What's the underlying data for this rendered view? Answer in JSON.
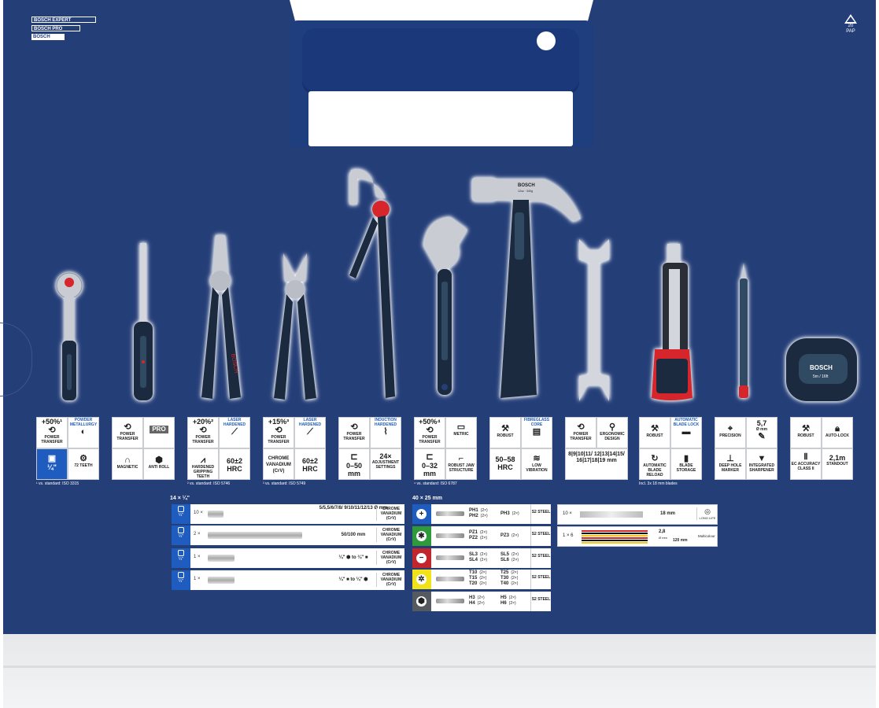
{
  "brand": {
    "expert": "BOSCH EXPERT",
    "pro": "BOSCH PRO",
    "bosch": "BOSCH"
  },
  "recycle": {
    "code": "20",
    "label": "PAP"
  },
  "colors": {
    "board": "#243e78",
    "accent_blue": "#1e5dbf",
    "tool_red": "#d6262c",
    "handle_dark": "#1b2a3f"
  },
  "tool_marks": {
    "pliers_logo": "BOSCH",
    "hammer_logo": "BOSCH",
    "hammer_weight": "12oz · 340g",
    "tape_logo": "BOSCH",
    "tape_size": "5m / 16ft"
  },
  "cards": [
    {
      "id": "ratchet",
      "tl_top": "+50%¹",
      "tl_label": "POWER TRANSFER",
      "tr_label": "POWDER METALLURGY",
      "bl_value": "¼\"",
      "br_label": "72 TEETH",
      "footnote": "¹ vs. standard: ISO 3315"
    },
    {
      "id": "screwdriver",
      "tl_label": "POWER TRANSFER",
      "tr_label": "PRO",
      "bl_label": "MAGNETIC",
      "br_label": "ANTI ROLL",
      "footnote": ""
    },
    {
      "id": "combination-pliers",
      "tl_top": "+20%²",
      "tl_label": "POWER TRANSFER",
      "tr_label": "LASER HARDENED",
      "bl_label": "HARDENED GRIPPING TEETH",
      "br_value": "60±2 HRC",
      "footnote": "² vs. standard: ISO 5746"
    },
    {
      "id": "side-cutter",
      "tl_top": "+15%³",
      "tl_label": "POWER TRANSFER",
      "tr_label": "LASER HARDENED",
      "bl_value": "CHROME VANADIUM (CrV)",
      "br_value": "60±2 HRC",
      "footnote": "³ vs. standard: ISO 5749"
    },
    {
      "id": "water-pump-pliers",
      "tl_label": "POWER TRANSFER",
      "tr_label": "INDUCTION HARDENED",
      "bl_value": "0–50 mm",
      "br_top": "24×",
      "br_label": "ADJUSTMENT SETTINGS",
      "footnote": ""
    },
    {
      "id": "adjustable-wrench",
      "tl_top": "+50%⁴",
      "tl_label": "POWER TRANSFER",
      "tr_label": "METRIC",
      "bl_value": "0–32 mm",
      "br_label": "ROBUST JAW STRUCTURE",
      "footnote": "⁴ vs. standard: ISO 6787"
    },
    {
      "id": "hammer",
      "tl_label": "ROBUST",
      "tr_label": "FIBREGLASS CORE",
      "bl_value": "50–58 HRC",
      "br_label": "LOW VIBRATION",
      "footnote": ""
    },
    {
      "id": "open-end-wrench",
      "tl_label": "POWER TRANSFER",
      "tr_label": "ERGONOMIC DESIGN",
      "bottom_value": "8|9|10|11/ 12|13|14|15/ 16|17|18|19 mm",
      "footnote": ""
    },
    {
      "id": "utility-knife",
      "tl_label": "ROBUST",
      "tr_label": "AUTOMATIC BLADE LOCK",
      "bl_label": "AUTOMATIC BLADE RELOAD",
      "br_label": "BLADE STORAGE",
      "footnote": "Incl. 3x 18 mm blades"
    },
    {
      "id": "pencil",
      "tl_label": "PRECISION",
      "tr_top": "5,7",
      "tr_label": "Ø mm",
      "bl_label": "DEEP HOLE MARKER",
      "br_label": "INTEGRATED SHARPENER",
      "footnote": ""
    },
    {
      "id": "tape-measure",
      "tl_label": "ROBUST",
      "tr_label": "AUTO-LOCK",
      "bl_label": "EC ACCURACY CLASS II",
      "br_top": "2,1m",
      "br_label": "STANDOUT",
      "footnote": ""
    }
  ],
  "socket_table": {
    "title": "14 × ¼\"",
    "drive": "¼\"",
    "rows": [
      {
        "qty": "10 ×",
        "sizes": "5/5,5/6/7/8/ 9/10/11/12/13 Ø mm",
        "material": "CHROME VANADIUM (CrV)"
      },
      {
        "qty": "2 ×",
        "sizes": "50/100 mm",
        "material": "CHROME VANADIUM (CrV)"
      },
      {
        "qty": "1 ×",
        "sizes": "¼\" ⬢ to ¼\" ■",
        "material": "CHROME VANADIUM (CrV)"
      },
      {
        "qty": "1 ×",
        "sizes": "¼\" ■ to ¼\" ⬢",
        "material": "CHROME VANADIUM (CrV)"
      }
    ]
  },
  "bit_table": {
    "title": "40 × 25 mm",
    "rows": [
      {
        "symbol": "+",
        "color": "#1e5dbf",
        "a1": "PH1",
        "a1q": "(2×)",
        "a2": "PH2",
        "a2q": "(2×)",
        "b1": "PH3",
        "b1q": "(2×)",
        "b2": "",
        "b2q": "",
        "b3": "",
        "b3q": "",
        "a3": "",
        "a3q": "",
        "steel": "S2 STEEL"
      },
      {
        "symbol": "✱",
        "color": "#2e9a3c",
        "a1": "PZ1",
        "a1q": "(2×)",
        "a2": "PZ2",
        "a2q": "(2×)",
        "b1": "PZ3",
        "b1q": "(2×)",
        "b2": "",
        "b2q": "",
        "b3": "",
        "b3q": "",
        "a3": "",
        "a3q": "",
        "steel": "S2 STEEL"
      },
      {
        "symbol": "−",
        "color": "#c0262c",
        "a1": "SL3",
        "a1q": "(2×)",
        "a2": "SL4",
        "a2q": "(2×)",
        "b1": "SL5",
        "b1q": "(2×)",
        "b2": "SL6",
        "b2q": "(2×)",
        "b3": "",
        "b3q": "",
        "a3": "",
        "a3q": "",
        "steel": "S2 STEEL"
      },
      {
        "symbol": "✲",
        "color": "#f2e21a",
        "a1": "T10",
        "a1q": "(2×)",
        "a2": "T15",
        "a2q": "(2×)",
        "a3": "T20",
        "a3q": "(2×)",
        "b1": "T25",
        "b1q": "(2×)",
        "b2": "T30",
        "b2q": "(2×)",
        "b3": "T40",
        "b3q": "(2×)",
        "steel": "S2 STEEL"
      },
      {
        "symbol": "⬢",
        "color": "#555a60",
        "a1": "H3",
        "a1q": "(2×)",
        "a2": "H4",
        "a2q": "(2×)",
        "b1": "H5",
        "b1q": "(2×)",
        "b2": "H6",
        "b2q": "(2×)",
        "b3": "",
        "b3q": "",
        "a3": "",
        "a3q": "",
        "steel": "S2 STEEL"
      }
    ]
  },
  "blade_table": {
    "row1": {
      "qty": "10 ×",
      "size": "18 mm",
      "feature": "LONG LIFE"
    },
    "row2": {
      "qty": "1 × 6",
      "size_top": "2,8",
      "size_unit": "Ø mm",
      "length": "120 mm",
      "feature": "Multicolour"
    }
  }
}
